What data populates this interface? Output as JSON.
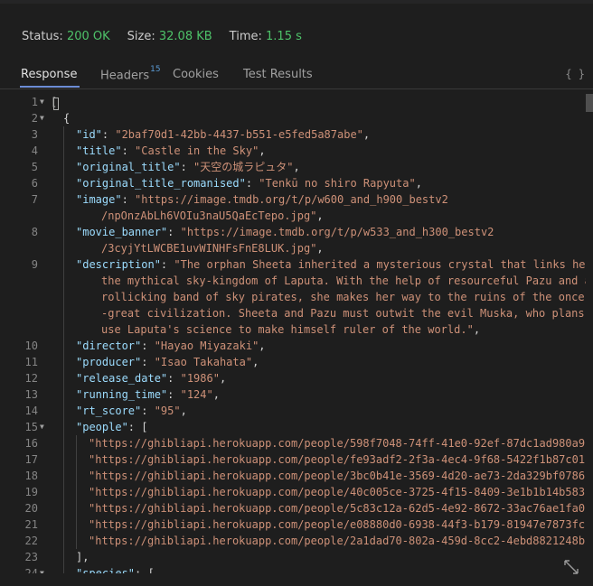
{
  "status": {
    "status_label": "Status:",
    "status_value": "200 OK",
    "size_label": "Size:",
    "size_value": "32.08 KB",
    "time_label": "Time:",
    "time_value": "1.15 s",
    "value_color": "#4ec269"
  },
  "tabs": [
    {
      "label": "Response",
      "active": true
    },
    {
      "label": "Headers",
      "badge": "15"
    },
    {
      "label": "Cookies"
    },
    {
      "label": "Test Results"
    }
  ],
  "toolbar": {
    "braces": "{ }"
  },
  "editor": {
    "lines": [
      {
        "n": "1",
        "fold": true,
        "tokens": [
          [
            "p",
            "["
          ]
        ],
        "indent": 0
      },
      {
        "n": "2",
        "fold": true,
        "tokens": [
          [
            "p",
            "{"
          ]
        ],
        "indent": 1
      },
      {
        "n": "3",
        "tokens": [
          [
            "k",
            "\"id\""
          ],
          [
            "p",
            ": "
          ],
          [
            "s",
            "\"2baf70d1-42bb-4437-b551-e5fed5a87abe\""
          ],
          [
            "p",
            ","
          ]
        ],
        "indent": 2
      },
      {
        "n": "4",
        "tokens": [
          [
            "k",
            "\"title\""
          ],
          [
            "p",
            ": "
          ],
          [
            "s",
            "\"Castle in the Sky\""
          ],
          [
            "p",
            ","
          ]
        ],
        "indent": 2
      },
      {
        "n": "5",
        "tokens": [
          [
            "k",
            "\"original_title\""
          ],
          [
            "p",
            ": "
          ],
          [
            "s",
            "\"天空の城ラピュタ\""
          ],
          [
            "p",
            ","
          ]
        ],
        "indent": 2
      },
      {
        "n": "6",
        "tokens": [
          [
            "k",
            "\"original_title_romanised\""
          ],
          [
            "p",
            ": "
          ],
          [
            "s",
            "\"Tenkū no shiro Rapyuta\""
          ],
          [
            "p",
            ","
          ]
        ],
        "indent": 2
      },
      {
        "n": "7",
        "tokens": [
          [
            "k",
            "\"image\""
          ],
          [
            "p",
            ": "
          ],
          [
            "s",
            "\"https://image.tmdb.org/t/p/w600_and_h900_bestv2"
          ]
        ],
        "indent": 2
      },
      {
        "n": "",
        "tokens": [
          [
            "s",
            "/npOnzAbLh6VOIu3naU5QaEcTepo.jpg\""
          ],
          [
            "p",
            ","
          ]
        ],
        "indent": 4
      },
      {
        "n": "8",
        "tokens": [
          [
            "k",
            "\"movie_banner\""
          ],
          [
            "p",
            ": "
          ],
          [
            "s",
            "\"https://image.tmdb.org/t/p/w533_and_h300_bestv2"
          ]
        ],
        "indent": 2
      },
      {
        "n": "",
        "tokens": [
          [
            "s",
            "/3cyjYtLWCBE1uvWINHFsFnE8LUK.jpg\""
          ],
          [
            "p",
            ","
          ]
        ],
        "indent": 4
      },
      {
        "n": "9",
        "tokens": [
          [
            "k",
            "\"description\""
          ],
          [
            "p",
            ": "
          ],
          [
            "s",
            "\"The orphan Sheeta inherited a mysterious crystal that links her to"
          ]
        ],
        "indent": 2
      },
      {
        "n": "",
        "tokens": [
          [
            "s",
            "the mythical sky-kingdom of Laputa. With the help of resourceful Pazu and a"
          ]
        ],
        "indent": 4
      },
      {
        "n": "",
        "tokens": [
          [
            "s",
            "rollicking band of sky pirates, she makes her way to the ruins of the once"
          ]
        ],
        "indent": 4
      },
      {
        "n": "",
        "tokens": [
          [
            "s",
            "-great civilization. Sheeta and Pazu must outwit the evil Muska, who plans to"
          ]
        ],
        "indent": 4
      },
      {
        "n": "",
        "tokens": [
          [
            "s",
            "use Laputa's science to make himself ruler of the world.\""
          ],
          [
            "p",
            ","
          ]
        ],
        "indent": 4
      },
      {
        "n": "10",
        "tokens": [
          [
            "k",
            "\"director\""
          ],
          [
            "p",
            ": "
          ],
          [
            "s",
            "\"Hayao Miyazaki\""
          ],
          [
            "p",
            ","
          ]
        ],
        "indent": 2
      },
      {
        "n": "11",
        "tokens": [
          [
            "k",
            "\"producer\""
          ],
          [
            "p",
            ": "
          ],
          [
            "s",
            "\"Isao Takahata\""
          ],
          [
            "p",
            ","
          ]
        ],
        "indent": 2
      },
      {
        "n": "12",
        "tokens": [
          [
            "k",
            "\"release_date\""
          ],
          [
            "p",
            ": "
          ],
          [
            "s",
            "\"1986\""
          ],
          [
            "p",
            ","
          ]
        ],
        "indent": 2
      },
      {
        "n": "13",
        "tokens": [
          [
            "k",
            "\"running_time\""
          ],
          [
            "p",
            ": "
          ],
          [
            "s",
            "\"124\""
          ],
          [
            "p",
            ","
          ]
        ],
        "indent": 2
      },
      {
        "n": "14",
        "tokens": [
          [
            "k",
            "\"rt_score\""
          ],
          [
            "p",
            ": "
          ],
          [
            "s",
            "\"95\""
          ],
          [
            "p",
            ","
          ]
        ],
        "indent": 2
      },
      {
        "n": "15",
        "fold": true,
        "tokens": [
          [
            "k",
            "\"people\""
          ],
          [
            "p",
            ": ["
          ]
        ],
        "indent": 2
      },
      {
        "n": "16",
        "tokens": [
          [
            "s",
            "\"https://ghibliapi.herokuapp.com/people/598f7048-74ff-41e0-92ef-87dc1ad980a9\""
          ],
          [
            "p",
            ","
          ]
        ],
        "indent": 3
      },
      {
        "n": "17",
        "tokens": [
          [
            "s",
            "\"https://ghibliapi.herokuapp.com/people/fe93adf2-2f3a-4ec4-9f68-5422f1b87c01\""
          ],
          [
            "p",
            ","
          ]
        ],
        "indent": 3
      },
      {
        "n": "18",
        "tokens": [
          [
            "s",
            "\"https://ghibliapi.herokuapp.com/people/3bc0b41e-3569-4d20-ae73-2da329bf0786\""
          ],
          [
            "p",
            ","
          ]
        ],
        "indent": 3
      },
      {
        "n": "19",
        "tokens": [
          [
            "s",
            "\"https://ghibliapi.herokuapp.com/people/40c005ce-3725-4f15-8409-3e1b1b14b583\""
          ],
          [
            "p",
            ","
          ]
        ],
        "indent": 3
      },
      {
        "n": "20",
        "tokens": [
          [
            "s",
            "\"https://ghibliapi.herokuapp.com/people/5c83c12a-62d5-4e92-8672-33ac76ae1fa0\""
          ],
          [
            "p",
            ","
          ]
        ],
        "indent": 3
      },
      {
        "n": "21",
        "tokens": [
          [
            "s",
            "\"https://ghibliapi.herokuapp.com/people/e08880d0-6938-44f3-b179-81947e7873fc\""
          ],
          [
            "p",
            ","
          ]
        ],
        "indent": 3
      },
      {
        "n": "22",
        "tokens": [
          [
            "s",
            "\"https://ghibliapi.herokuapp.com/people/2a1dad70-802a-459d-8cc2-4ebd8821248b\""
          ]
        ],
        "indent": 3
      },
      {
        "n": "23",
        "tokens": [
          [
            "p",
            "],"
          ]
        ],
        "indent": 2
      },
      {
        "n": "24",
        "fold": true,
        "tokens": [
          [
            "k",
            "\"species\""
          ],
          [
            "p",
            ": ["
          ]
        ],
        "indent": 2
      }
    ]
  },
  "icons": {
    "resize": "resize-diagonal-icon"
  }
}
